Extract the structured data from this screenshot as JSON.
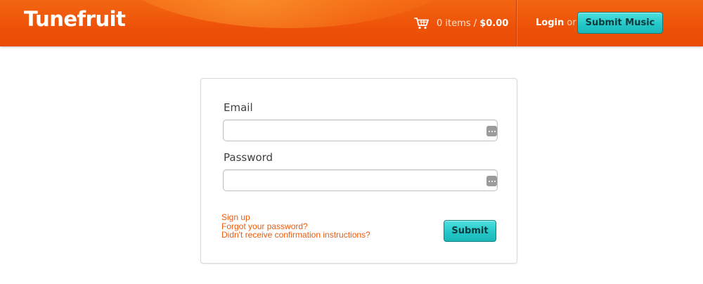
{
  "header": {
    "logo": "Tunefruit",
    "cart": {
      "icon": "cart-icon",
      "count": "0 items",
      "separator": "/",
      "total": "$0.00"
    },
    "login_label": "Login",
    "or_label": "or",
    "submit_music_label": "Submit Music"
  },
  "form": {
    "email_label": "Email",
    "email_value": "",
    "email_placeholder": "",
    "password_label": "Password",
    "password_value": "",
    "password_placeholder": "",
    "field_icon": "more-dots-icon",
    "links": {
      "sign_up": "Sign up",
      "forgot_password": "Forgot your password?",
      "confirmation": "Didn't receive confirmation instructions?"
    },
    "submit_label": "Submit"
  },
  "colors": {
    "header_orange": "#ee5309",
    "accent_teal": "#22c6c8",
    "link_orange": "#ef5a0b"
  }
}
